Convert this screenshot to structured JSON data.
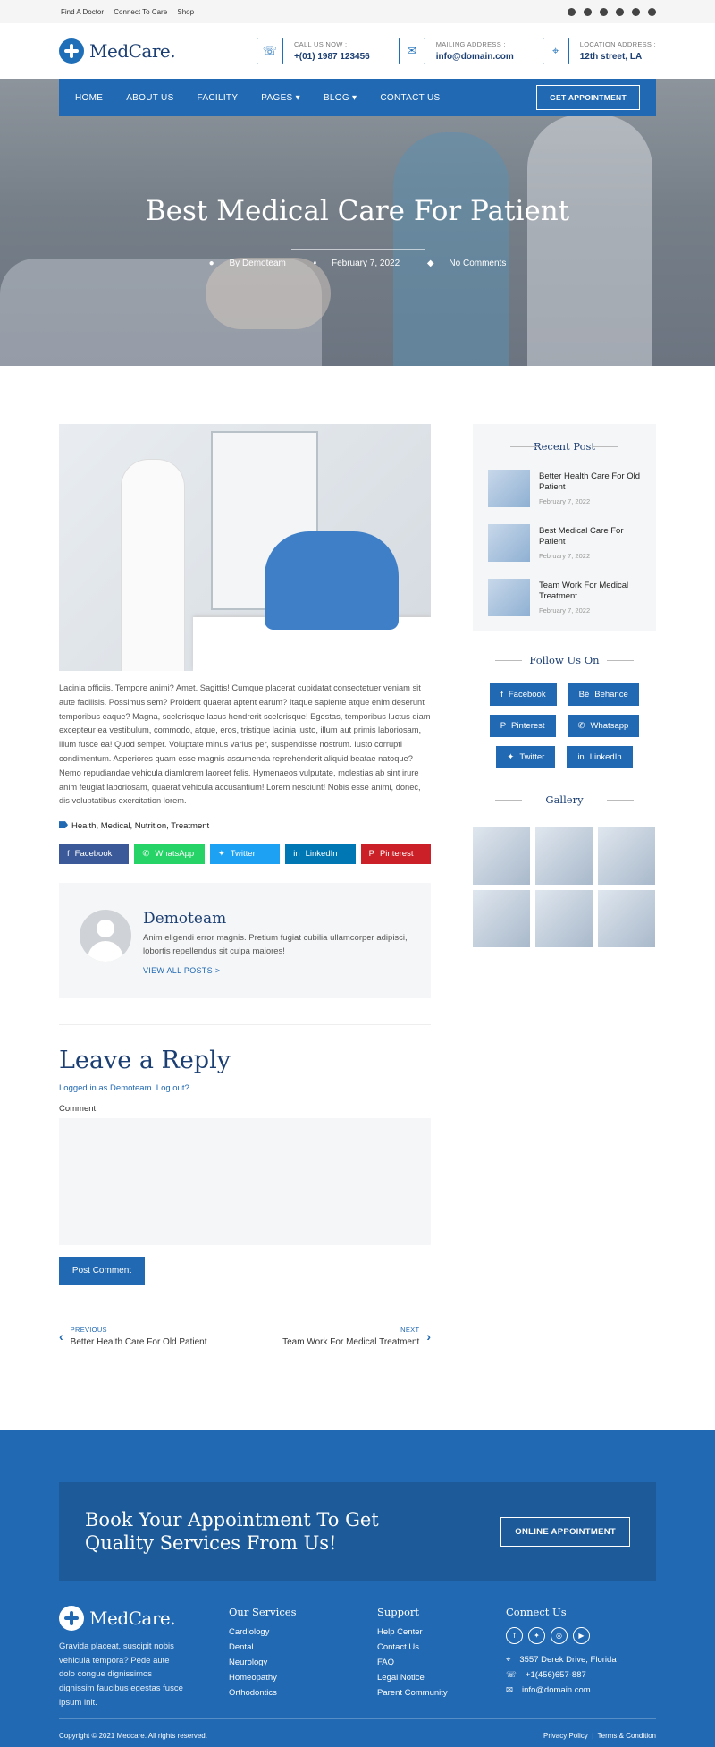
{
  "topbar": {
    "links": [
      "Find A Doctor",
      "Connect To Care",
      "Shop"
    ]
  },
  "header": {
    "logo": "MedCare.",
    "call_label": "CALL US NOW :",
    "call_value": "+(01) 1987 123456",
    "mail_label": "MAILING ADDRESS :",
    "mail_value": "info@domain.com",
    "loc_label": "LOCATION ADDRESS :",
    "loc_value": "12th street, LA"
  },
  "nav": {
    "items": [
      "HOME",
      "ABOUT US",
      "FACILITY",
      "PAGES",
      "BLOG",
      "CONTACT US"
    ],
    "cta": "GET APPOINTMENT"
  },
  "hero": {
    "title": "Best Medical Care For Patient",
    "author": "By Demoteam",
    "date": "February 7, 2022",
    "comments": "No Comments"
  },
  "post": {
    "text": "Lacinia officiis. Tempore animi? Amet. Sagittis! Cumque placerat cupidatat consectetuer veniam sit aute facilisis. Possimus sem? Proident quaerat aptent earum? Itaque sapiente atque enim deserunt temporibus eaque? Magna, scelerisque lacus hendrerit scelerisque! Egestas, temporibus luctus diam excepteur ea vestibulum, commodo, atque, eros, tristique lacinia justo, illum aut primis laboriosam, illum fusce ea! Quod semper. Voluptate minus varius per, suspendisse nostrum. Iusto corrupti condimentum. Asperiores quam esse magnis assumenda reprehenderit aliquid beatae natoque? Nemo repudiandae vehicula diamlorem laoreet felis. Hymenaeos vulputate, molestias ab sint irure anim feugiat laboriosam, quaerat vehicula accusantium! Lorem nesciunt! Nobis esse animi, donec, dis voluptatibus exercitation lorem.",
    "tags": "Health, Medical, Nutrition, Treatment",
    "share": [
      "Facebook",
      "WhatsApp",
      "Twitter",
      "LinkedIn",
      "Pinterest"
    ],
    "share_colors": [
      "#3b5998",
      "#25d366",
      "#1da1f2",
      "#0077b5",
      "#cb2027"
    ]
  },
  "author": {
    "name": "Demoteam",
    "bio": "Anim eligendi error magnis. Pretium fugiat cubilia ullamcorper adipisci, lobortis repellendus sit culpa maiores!",
    "link": "VIEW ALL POSTS >"
  },
  "reply": {
    "title": "Leave a Reply",
    "logged": "Logged in as Demoteam. Log out?",
    "comment_label": "Comment",
    "button": "Post Comment"
  },
  "postnav": {
    "prev_label": "PREVIOUS",
    "prev_title": "Better Health Care For Old Patient",
    "next_label": "NEXT",
    "next_title": "Team Work For Medical Treatment"
  },
  "sidebar": {
    "recent_title": "Recent Post",
    "recent": [
      {
        "title": "Better Health Care For Old Patient",
        "date": "February 7, 2022"
      },
      {
        "title": "Best Medical Care For Patient",
        "date": "February 7, 2022"
      },
      {
        "title": "Team Work For Medical Treatment",
        "date": "February 7, 2022"
      }
    ],
    "follow_title": "Follow Us On",
    "follow": [
      "Facebook",
      "Behance",
      "Pinterest",
      "Whatsapp",
      "Twitter",
      "LinkedIn"
    ],
    "gallery_title": "Gallery"
  },
  "footer": {
    "cta_text": "Book Your Appointment To Get Quality Services From Us!",
    "cta_button": "ONLINE APPOINTMENT",
    "logo": "MedCare.",
    "desc": "Gravida placeat, suscipit nobis vehicula tempora? Pede aute dolo congue dignissimos dignissim faucibus egestas fusce ipsum init.",
    "services_title": "Our Services",
    "services": [
      "Cardiology",
      "Dental",
      "Neurology",
      "Homeopathy",
      "Orthodontics"
    ],
    "support_title": "Support",
    "support": [
      "Help Center",
      "Contact Us",
      "FAQ",
      "Legal Notice",
      "Parent Community"
    ],
    "connect_title": "Connect Us",
    "address": "3557 Derek Drive, Florida",
    "phone": "+1(456)657-887",
    "email": "info@domain.com",
    "copyright": "Copyright © 2021 Medcare. All rights reserved.",
    "privacy": "Privacy Policy",
    "terms": "Terms & Condition"
  }
}
